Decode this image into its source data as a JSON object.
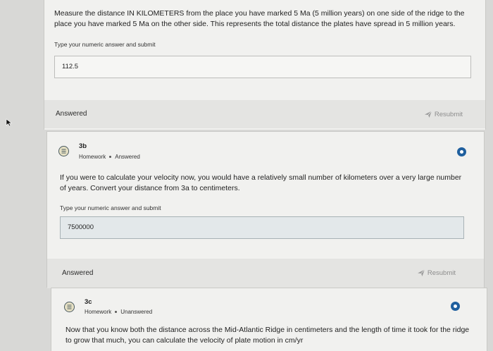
{
  "questions": [
    {
      "text": "Measure the distance IN KILOMETERS from the place you have marked 5 Ma (5 million years) on one side of the ridge to the place you have marked 5 Ma on the other side. This represents the total distance the plates have spread in 5 million years.",
      "hint": "Type your numeric answer and submit",
      "answer": "112.5",
      "status_label": "Answered",
      "resubmit_label": "Resubmit"
    },
    {
      "title": "3b",
      "meta_type": "Homework",
      "meta_status": "Answered",
      "text": "If you were to calculate your velocity now, you would have a relatively small number of kilometers over a very large number of years. Convert your distance from 3a to centimeters.",
      "hint": "Type your numeric answer and submit",
      "answer": "7500000",
      "status_label": "Answered",
      "resubmit_label": "Resubmit"
    },
    {
      "title": "3c",
      "meta_type": "Homework",
      "meta_status": "Unanswered",
      "text": "Now that you know both the distance across the Mid-Atlantic Ridge in centimeters and the length of time it took for the ridge to grow that much, you can calculate the velocity of plate motion in cm/yr"
    }
  ],
  "colors": {
    "accent": "#1f5f9e",
    "background": "#d8d8d6",
    "card": "#f1f1ef",
    "answered_bar": "#e4e4e2"
  },
  "icons": {
    "question": "list-icon",
    "resubmit": "send-icon",
    "status": "status-ring-icon"
  }
}
